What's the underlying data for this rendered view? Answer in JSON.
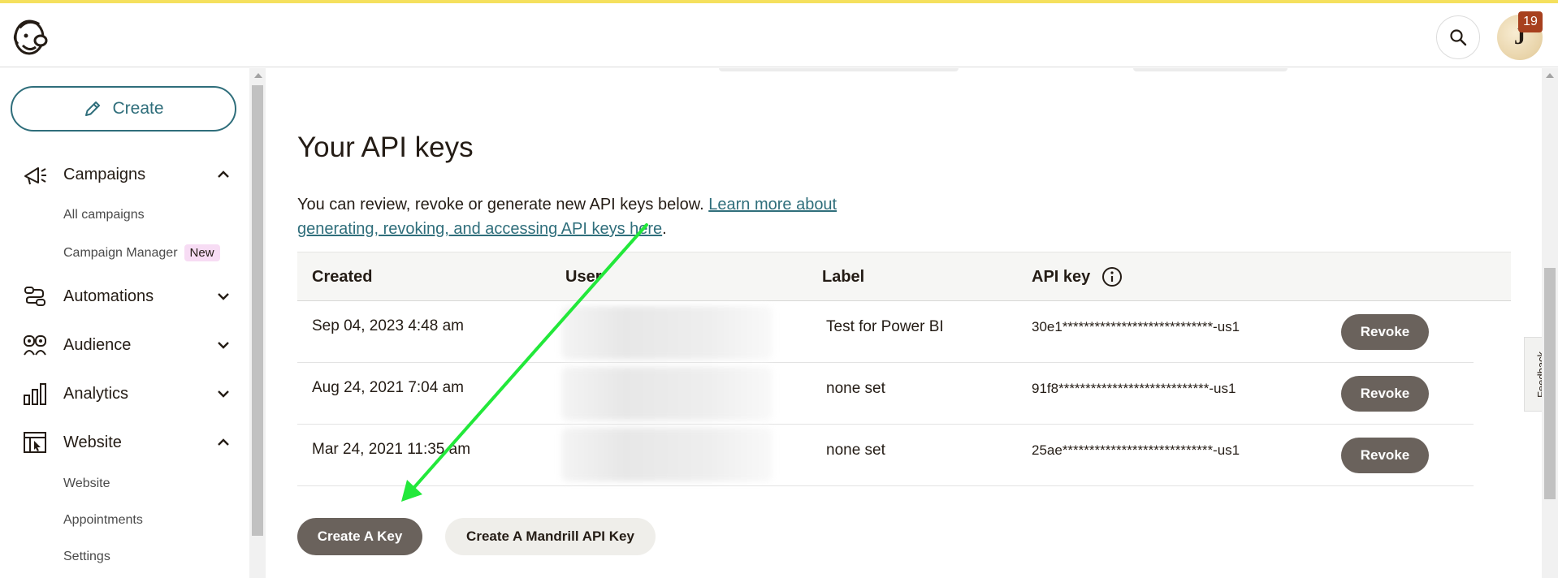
{
  "header": {
    "logo_name": "mailchimp-freddie-logo",
    "avatar_initial": "J",
    "notification_count": "19"
  },
  "sidebar": {
    "create_label": "Create",
    "items": [
      {
        "label": "Campaigns",
        "icon": "megaphone-icon",
        "expanded": true,
        "children": [
          {
            "label": "All campaigns"
          },
          {
            "label": "Campaign Manager",
            "tag": "New"
          }
        ]
      },
      {
        "label": "Automations",
        "icon": "automation-flow-icon",
        "expanded": false
      },
      {
        "label": "Audience",
        "icon": "audience-icon",
        "expanded": false
      },
      {
        "label": "Analytics",
        "icon": "bar-chart-icon",
        "expanded": false
      },
      {
        "label": "Website",
        "icon": "website-cursor-icon",
        "expanded": true,
        "children": [
          {
            "label": "Website"
          },
          {
            "label": "Appointments"
          },
          {
            "label": "Settings"
          }
        ]
      }
    ]
  },
  "main": {
    "title": "Your API keys",
    "description": "You can review, revoke or generate new API keys below. ",
    "learn_more_link": "Learn more about generating, revoking, and accessing API keys here",
    "period": ".",
    "table": {
      "headers": {
        "created": "Created",
        "user": "User",
        "label": "Label",
        "api_key": "API key"
      },
      "rows": [
        {
          "created": "Sep 04, 2023 4:48 am",
          "label": "Test for Power BI",
          "api_key": "30e1****************************-us1",
          "action": "Revoke"
        },
        {
          "created": "Aug 24, 2021 7:04 am",
          "label": "none set",
          "api_key": "91f8****************************-us1",
          "action": "Revoke"
        },
        {
          "created": "Mar 24, 2021 11:35 am",
          "label": "none set",
          "api_key": "25ae****************************-us1",
          "action": "Revoke"
        }
      ]
    },
    "create_key_label": "Create A Key",
    "create_mandrill_label": "Create A Mandrill API Key",
    "feedback_label": "Feedback"
  },
  "colors": {
    "accent_teal": "#2f6e7b",
    "button_dark": "#6a625c",
    "top_stripe": "#f5e05d",
    "annotation_arrow": "#22e83a",
    "badge": "#a7401e",
    "new_tag": "#f7dcf4"
  }
}
